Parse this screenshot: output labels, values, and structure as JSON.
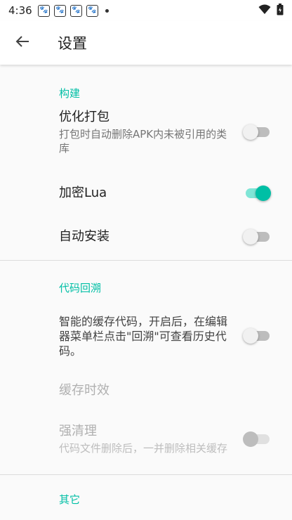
{
  "status_bar": {
    "time": "4:36",
    "notification_icons": [
      "paw-icon",
      "paw-icon",
      "paw-icon",
      "paw-icon"
    ]
  },
  "app_bar": {
    "title": "设置"
  },
  "sections": {
    "build": {
      "header": "构建",
      "optimize_pack": {
        "title": "优化打包",
        "summary": "打包时自动删除APK内未被引用的类库",
        "enabled": false
      },
      "encrypt_lua": {
        "title": "加密Lua",
        "enabled": true
      },
      "auto_install": {
        "title": "自动安装",
        "enabled": false
      }
    },
    "code_rollback": {
      "header": "代码回溯",
      "smart_cache": {
        "summary": "智能的缓存代码，开启后，在编辑器菜单栏点击\"回溯\"可查看历史代码。",
        "enabled": false
      },
      "cache_expiry": {
        "title": "缓存时效"
      },
      "force_clean": {
        "title": "强清理",
        "summary": "代码文件删除后，一并删除相关缓存",
        "enabled": false
      }
    },
    "other": {
      "header": "其它"
    }
  },
  "colors": {
    "accent": "#00bfa5",
    "accent_track": "#80e5d6"
  }
}
